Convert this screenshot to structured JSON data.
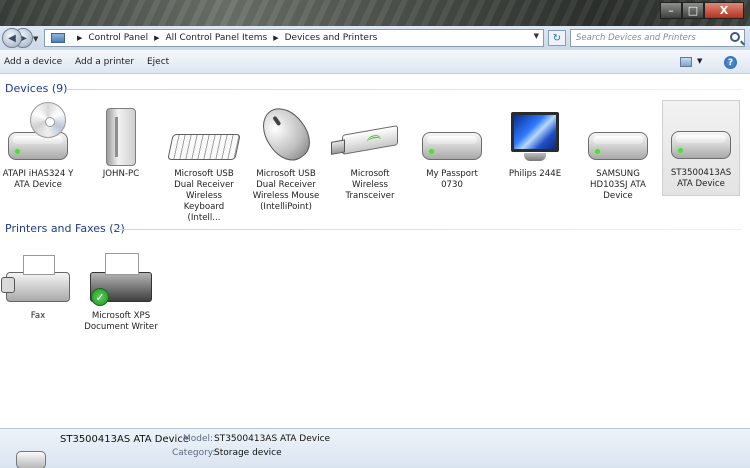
{
  "window": {
    "min_label": "–",
    "max_label": "□",
    "close_label": "X"
  },
  "address": {
    "breadcrumb": [
      "Control Panel",
      "All Control Panel Items",
      "Devices and Printers"
    ],
    "search_placeholder": "Search Devices and Printers"
  },
  "toolbar": {
    "add_device": "Add a device",
    "add_printer": "Add a printer",
    "eject": "Eject",
    "help": "?"
  },
  "groups": {
    "devices_header": "Devices (9)",
    "printers_header": "Printers and Faxes (2)"
  },
  "devices": [
    {
      "label": "ATAPI iHAS324 Y ATA Device",
      "icon": "optical-drive-icon"
    },
    {
      "label": "JOHN-PC",
      "icon": "computer-tower-icon"
    },
    {
      "label": "Microsoft USB Dual Receiver Wireless Keyboard (Intell...",
      "icon": "keyboard-icon"
    },
    {
      "label": "Microsoft USB Dual Receiver Wireless Mouse (IntelliPoint)",
      "icon": "mouse-icon"
    },
    {
      "label": "Microsoft Wireless Transceiver",
      "icon": "usb-transceiver-icon"
    },
    {
      "label": "My Passport 0730",
      "icon": "hard-drive-icon"
    },
    {
      "label": "Philips 244E",
      "icon": "monitor-icon"
    },
    {
      "label": "SAMSUNG HD103SJ ATA Device",
      "icon": "hard-drive-icon"
    },
    {
      "label": "ST3500413AS ATA Device",
      "icon": "hard-drive-icon",
      "selected": true
    }
  ],
  "printers": [
    {
      "label": "Fax",
      "icon": "fax-icon"
    },
    {
      "label": "Microsoft XPS Document Writer",
      "icon": "printer-icon",
      "default": true
    }
  ],
  "details": {
    "name": "ST3500413AS ATA Device",
    "model_key": "Model:",
    "model_value": "ST3500413AS ATA Device",
    "category_key": "Category:",
    "category_value": "Storage device"
  }
}
